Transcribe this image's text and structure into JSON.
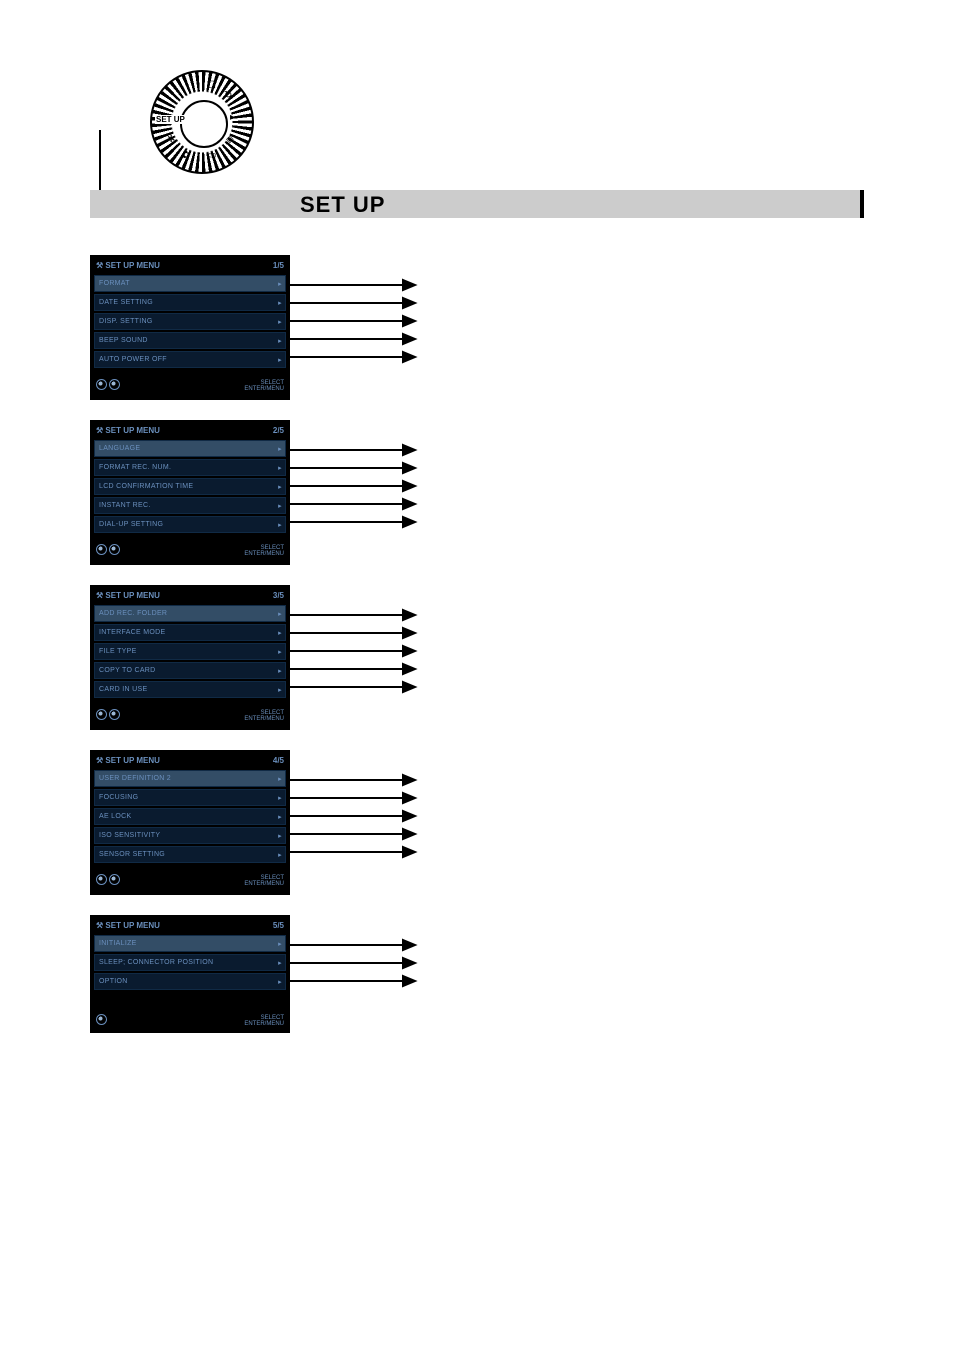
{
  "dial": {
    "label": "SET UP"
  },
  "header": {
    "title": "SET UP"
  },
  "panel_common": {
    "header_title": "SET UP MENU",
    "select_label": "SELECT",
    "action_label": "ENTER/MENU"
  },
  "panels": [
    {
      "page": "1/5",
      "items": [
        "FORMAT",
        "DATE SETTING",
        "DISP. SETTING",
        "BEEP SOUND",
        "AUTO POWER OFF"
      ]
    },
    {
      "page": "2/5",
      "items": [
        "LANGUAGE",
        "FORMAT REC. NUM.",
        "LCD CONFIRMATION TIME",
        "INSTANT REC.",
        "DIAL-UP SETTING"
      ]
    },
    {
      "page": "3/5",
      "items": [
        "ADD REC. FOLDER",
        "INTERFACE MODE",
        "FILE TYPE",
        "COPY TO CARD",
        "CARD IN USE"
      ]
    },
    {
      "page": "4/5",
      "items": [
        "USER DEFINITION 2",
        "FOCUSING",
        "AE LOCK",
        "ISO SENSITIVITY",
        "SENSOR SETTING"
      ]
    },
    {
      "page": "5/5",
      "items": [
        "INITIALIZE",
        "SLEEP; CONNECTOR POSITION",
        "OPTION"
      ]
    }
  ]
}
